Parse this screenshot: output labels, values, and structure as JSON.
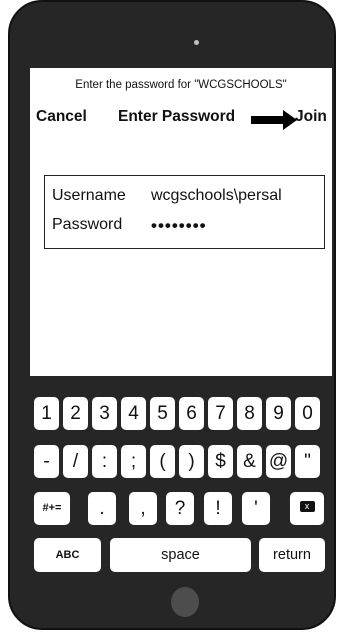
{
  "prompt": "Enter the password for \"WCGSCHOOLS\"",
  "nav": {
    "cancel_label": "Cancel",
    "title": "Enter Password",
    "join_label": "Join"
  },
  "form": {
    "username_label": "Username",
    "username_value": "wcgschools\\persal",
    "password_label": "Password",
    "password_value": "••••••••"
  },
  "keyboard": {
    "row1": [
      "1",
      "2",
      "3",
      "4",
      "5",
      "6",
      "7",
      "8",
      "9",
      "0"
    ],
    "row2": [
      "-",
      "/",
      ":",
      ";",
      "(",
      ")",
      "$",
      "&",
      "@",
      "\""
    ],
    "row3": {
      "symbols": "#+=",
      "keys": [
        ".",
        ",",
        "?",
        "!",
        "'"
      ],
      "delete_glyph": "x"
    },
    "row4": {
      "abc": "ABC",
      "space": "space",
      "return": "return"
    }
  },
  "icons": {
    "arrow": "right-arrow-icon",
    "delete": "delete-icon",
    "camera": "camera-icon",
    "home": "home-button-icon"
  },
  "colors": {
    "device": "#262626",
    "screen": "#ffffff",
    "key": "#ffffff",
    "keyboard": "#262626"
  }
}
